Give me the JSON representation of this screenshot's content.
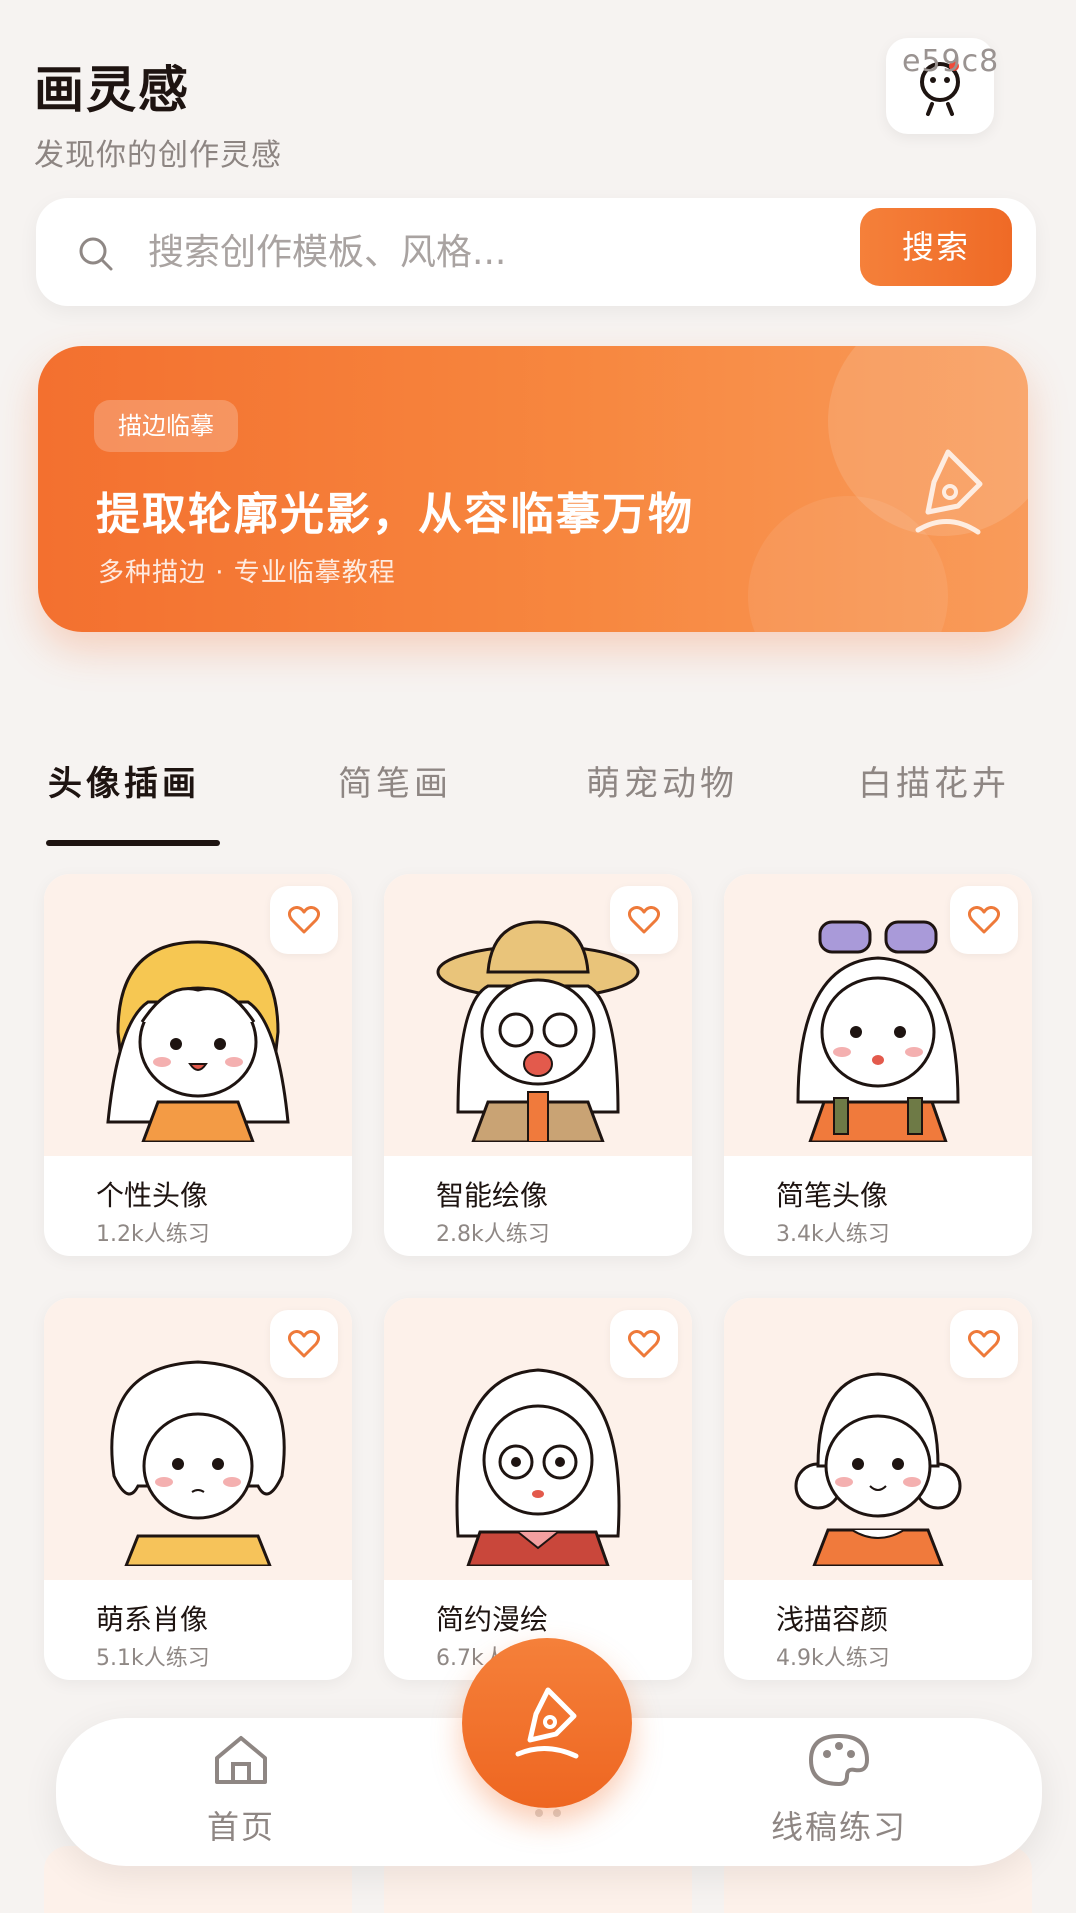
{
  "header": {
    "title": "画灵感",
    "subtitle": "发现你的创作灵感",
    "avatar_code": "e59c8"
  },
  "search": {
    "placeholder": "搜索创作模板、风格...",
    "button_label": "搜索"
  },
  "banner": {
    "tag": "描边临摹",
    "title": "提取轮廓光影，从容临摹万物",
    "subtitle": "多种描边 · 专业临摹教程"
  },
  "tabs": [
    {
      "label": "头像插画",
      "active": true
    },
    {
      "label": "简笔画",
      "active": false
    },
    {
      "label": "萌宠动物",
      "active": false
    },
    {
      "label": "白描花卉",
      "active": false
    }
  ],
  "cards": [
    {
      "title": "个性头像",
      "count": "1.2k人练习"
    },
    {
      "title": "智能绘像",
      "count": "2.8k人练习"
    },
    {
      "title": "简笔头像",
      "count": "3.4k人练习"
    },
    {
      "title": "萌系肖像",
      "count": "5.1k人练习"
    },
    {
      "title": "简约漫绘",
      "count": "6.7k人练习"
    },
    {
      "title": "浅描容颜",
      "count": "4.9k人练习"
    }
  ],
  "bottom_nav": {
    "home_label": "首页",
    "practice_label": "线稿练习"
  },
  "colors": {
    "accent": "#f3702f",
    "background": "#f6f3f1",
    "card_art_bg": "#fdf1ea"
  }
}
